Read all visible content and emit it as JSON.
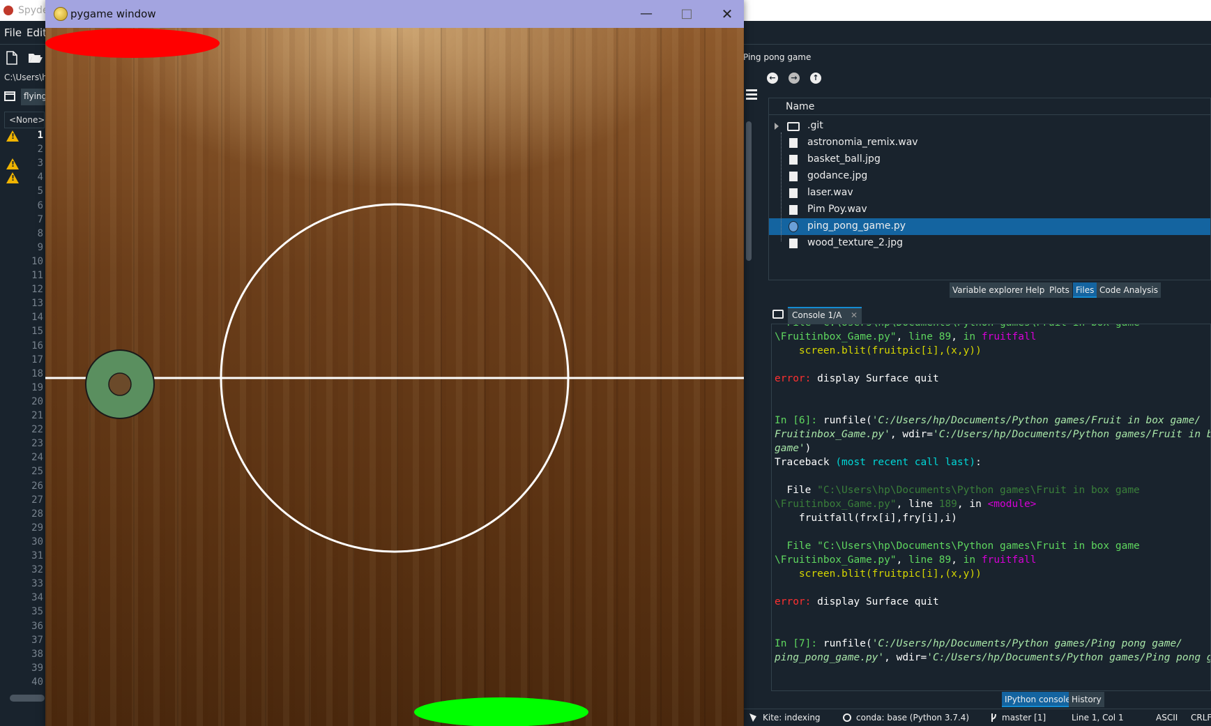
{
  "spyder": {
    "app_name": "Spyder",
    "menu": [
      "File",
      "Edit"
    ],
    "path": "C:\\Users\\hp\\Documents\\Python games",
    "editor_tab": "flying",
    "editor_selector": "<None>",
    "line_numbers": [
      1,
      2,
      3,
      4,
      5,
      6,
      7,
      8,
      9,
      10,
      11,
      12,
      13,
      14,
      15,
      16,
      17,
      18,
      19,
      20,
      21,
      22,
      23,
      24,
      25,
      26,
      27,
      28,
      29,
      30,
      31,
      32,
      33,
      34,
      35,
      36,
      37,
      38,
      39,
      40
    ],
    "warning_lines": [
      1,
      3,
      4
    ],
    "files_pane": {
      "title": "Ping pong game",
      "column_header": "Name",
      "items": [
        {
          "name": ".git",
          "type": "folder"
        },
        {
          "name": "astronomia_remix.wav",
          "type": "audio"
        },
        {
          "name": "basket_ball.jpg",
          "type": "image"
        },
        {
          "name": "godance.jpg",
          "type": "image"
        },
        {
          "name": "laser.wav",
          "type": "audio"
        },
        {
          "name": "Pim Poy.wav",
          "type": "audio"
        },
        {
          "name": "ping_pong_game.py",
          "type": "python",
          "selected": true
        },
        {
          "name": "wood_texture_2.jpg",
          "type": "image"
        }
      ]
    },
    "pane_tabs": [
      "Variable explorer",
      "Help",
      "Plots",
      "Files",
      "Code Analysis"
    ],
    "active_pane_tab": "Files",
    "console": {
      "tab_label": "Console 1/A",
      "lines": [
        [
          [
            "  File \"C:\\Users\\hp\\Documents\\Python games\\Fruit in box game",
            "c-g"
          ]
        ],
        [
          [
            "\\Fruitinbox_Game.py\"",
            "c-g"
          ],
          [
            ", ",
            "c-w"
          ],
          [
            "line 89",
            "c-g"
          ],
          [
            ", ",
            "c-w"
          ],
          [
            "in ",
            "c-g"
          ],
          [
            "fruitfall",
            "c-m"
          ]
        ],
        [
          [
            "    screen.blit(fruitpic[i],(x,y))",
            "c-y"
          ]
        ],
        [
          [
            "",
            "c-w"
          ]
        ],
        [
          [
            "error: ",
            "c-r"
          ],
          [
            "display Surface quit",
            "c-w"
          ]
        ],
        [
          [
            "",
            "c-w"
          ]
        ],
        [
          [
            "",
            "c-w"
          ]
        ],
        [
          [
            "In [6]: ",
            "c-g"
          ],
          [
            "runfile(",
            "c-w"
          ],
          [
            "'C:/Users/hp/Documents/Python games/Fruit in box game/",
            "c-lg"
          ]
        ],
        [
          [
            "Fruitinbox_Game.py'",
            "c-lg"
          ],
          [
            ", wdir=",
            "c-w"
          ],
          [
            "'C:/Users/hp/Documents/Python games/Fruit in box",
            "c-lg"
          ]
        ],
        [
          [
            "game'",
            "c-lg"
          ],
          [
            ")",
            "c-w"
          ]
        ],
        [
          [
            "Traceback ",
            "c-w"
          ],
          [
            "(most recent call last)",
            "c-cy"
          ],
          [
            ":",
            "c-w"
          ]
        ],
        [
          [
            "",
            "c-w"
          ]
        ],
        [
          [
            "  File ",
            "c-w"
          ],
          [
            "\"C:\\Users\\hp\\Documents\\Python games\\Fruit in box game",
            "c-dg"
          ]
        ],
        [
          [
            "\\Fruitinbox_Game.py\"",
            "c-dg"
          ],
          [
            ", line ",
            "c-w"
          ],
          [
            "189",
            "c-dg"
          ],
          [
            ", in ",
            "c-w"
          ],
          [
            "<module>",
            "c-m"
          ]
        ],
        [
          [
            "    fruitfall(frx[i],fry[i],i)",
            "c-w"
          ]
        ],
        [
          [
            "",
            "c-w"
          ]
        ],
        [
          [
            "  File \"C:\\Users\\hp\\Documents\\Python games\\Fruit in box game",
            "c-g"
          ]
        ],
        [
          [
            "\\Fruitinbox_Game.py\"",
            "c-g"
          ],
          [
            ", ",
            "c-w"
          ],
          [
            "line 89",
            "c-g"
          ],
          [
            ", ",
            "c-w"
          ],
          [
            "in ",
            "c-g"
          ],
          [
            "fruitfall",
            "c-m"
          ]
        ],
        [
          [
            "    screen.blit(fruitpic[i],(x,y))",
            "c-y"
          ]
        ],
        [
          [
            "",
            "c-w"
          ]
        ],
        [
          [
            "error: ",
            "c-r"
          ],
          [
            "display Surface quit",
            "c-w"
          ]
        ],
        [
          [
            "",
            "c-w"
          ]
        ],
        [
          [
            "",
            "c-w"
          ]
        ],
        [
          [
            "In [7]: ",
            "c-g"
          ],
          [
            "runfile(",
            "c-w"
          ],
          [
            "'C:/Users/hp/Documents/Python games/Ping pong game/",
            "c-lg"
          ]
        ],
        [
          [
            "ping_pong_game.py'",
            "c-lg"
          ],
          [
            ", wdir=",
            "c-w"
          ],
          [
            "'C:/Users/hp/Documents/Python games/Ping pong game'",
            "c-lg"
          ]
        ]
      ]
    },
    "bottom_tabs": [
      "IPython console",
      "History"
    ],
    "active_bottom_tab": "IPython console",
    "status": {
      "kite": "Kite: indexing",
      "conda": "conda: base (Python 3.7.4)",
      "git": "master [1]",
      "position": "Line 1, Col 1",
      "encoding": "ASCII",
      "eol": "CRLF"
    }
  },
  "pygame": {
    "title": "pygame window",
    "colors": {
      "top_paddle": "#ff0000",
      "bottom_paddle": "#00ff00",
      "puck": "#5a8f5f",
      "court_lines": "#ffffff"
    },
    "icons": [
      "pygame-logo-icon",
      "minimize-icon",
      "maximize-icon",
      "close-icon"
    ]
  }
}
